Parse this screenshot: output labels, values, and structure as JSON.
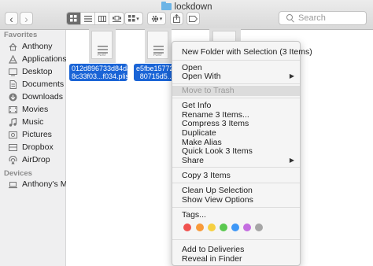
{
  "window": {
    "title": "lockdown"
  },
  "toolbar": {
    "back_glyph": "‹",
    "forward_glyph": "›",
    "arrange_caret": "▾",
    "action_caret": "▾",
    "search_placeholder": "Search"
  },
  "sidebar": {
    "favorites_header": "Favorites",
    "favorites": [
      {
        "label": "Anthony",
        "icon": "home-icon"
      },
      {
        "label": "Applications",
        "icon": "applications-icon"
      },
      {
        "label": "Desktop",
        "icon": "desktop-icon"
      },
      {
        "label": "Documents",
        "icon": "documents-icon"
      },
      {
        "label": "Downloads",
        "icon": "downloads-icon"
      },
      {
        "label": "Movies",
        "icon": "movies-icon"
      },
      {
        "label": "Music",
        "icon": "music-icon"
      },
      {
        "label": "Pictures",
        "icon": "pictures-icon"
      },
      {
        "label": "Dropbox",
        "icon": "dropbox-icon"
      },
      {
        "label": "AirDrop",
        "icon": "airdrop-icon"
      }
    ],
    "devices_header": "Devices",
    "devices": [
      {
        "label": "Anthony's M...",
        "icon": "laptop-icon"
      }
    ]
  },
  "files": [
    {
      "name_line1": "012d896733d84da",
      "name_line2": "8c33f03...f034.plist",
      "icon_text": "PLIST",
      "selected": true
    },
    {
      "name_line1": "e5fbe157725",
      "name_line2": "80715d5...",
      "icon_text": "PLIST",
      "selected": true
    },
    {
      "icon_text": "",
      "selected": true
    }
  ],
  "context_menu": {
    "items": [
      {
        "label": "New Folder with Selection (3 Items)"
      },
      {
        "label": "Open"
      },
      {
        "label": "Open With",
        "submenu": "▶"
      },
      {
        "label": "Move to Trash",
        "disabled": true
      },
      {
        "label": "Get Info"
      },
      {
        "label": "Rename 3 Items..."
      },
      {
        "label": "Compress 3 Items"
      },
      {
        "label": "Duplicate"
      },
      {
        "label": "Make Alias"
      },
      {
        "label": "Quick Look 3 Items"
      },
      {
        "label": "Share",
        "submenu": "▶"
      },
      {
        "label": "Copy 3 Items"
      },
      {
        "label": "Clean Up Selection"
      },
      {
        "label": "Show View Options"
      },
      {
        "label": "Tags..."
      },
      {
        "label": "Add to Deliveries"
      },
      {
        "label": "Reveal in Finder"
      }
    ],
    "tag_colors": [
      {
        "name": "red",
        "hex": "#f0524f"
      },
      {
        "name": "orange",
        "hex": "#f89a3a"
      },
      {
        "name": "yellow",
        "hex": "#f6d041"
      },
      {
        "name": "green",
        "hex": "#5ac84f"
      },
      {
        "name": "blue",
        "hex": "#3e97f6"
      },
      {
        "name": "purple",
        "hex": "#c46ee0"
      },
      {
        "name": "gray",
        "hex": "#a6a6a6"
      }
    ]
  },
  "colors": {
    "selection": "#1a64d6",
    "folder": "#6cb4e6"
  }
}
